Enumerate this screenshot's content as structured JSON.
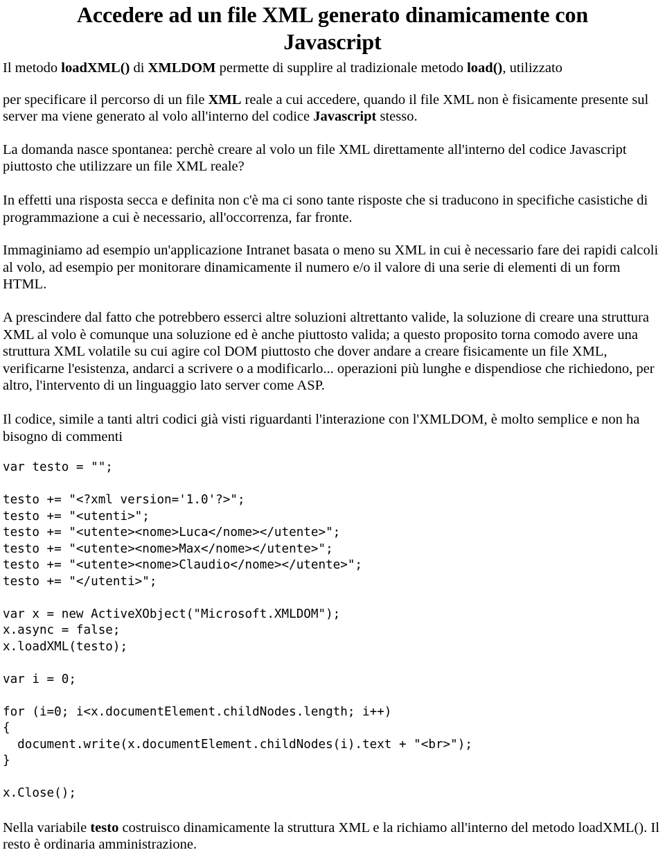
{
  "document": {
    "title_line1": "Accedere ad un file XML generato dinamicamente con",
    "title_line2": "Javascript",
    "lead": {
      "part1_a": "Il metodo ",
      "part1_b": "loadXML()",
      "part1_c": " di ",
      "part1_d": "XMLDOM",
      "part1_e": " permette di supplire al tradizionale metodo ",
      "part1_f": "load()",
      "part1_g": ", utilizzato",
      "part2_a": "per specificare il percorso di un file ",
      "part2_b": "XML",
      "part2_c": " reale a cui accedere, quando il file XML non è fisicamente presente sul server ma viene generato al volo all'interno del codice ",
      "part2_d": "Javascript",
      "part2_e": " stesso."
    },
    "paragraphs": [
      "La domanda nasce spontanea: perchè creare al volo un file XML direttamente all'interno del codice Javascript piuttosto che utilizzare un file XML reale?",
      "In effetti una risposta secca e definita non c'è ma ci sono tante risposte che si traducono in specifiche casistiche di programmazione a cui è necessario, all'occorrenza, far fronte.",
      "Immaginiamo ad esempio un'applicazione Intranet basata o meno su XML in cui è necessario fare dei rapidi calcoli al volo, ad esempio per monitorare dinamicamente il numero e/o il valore di una serie di elementi di un form HTML.",
      "A prescindere dal fatto che potrebbero esserci altre soluzioni altrettanto valide, la soluzione di creare una struttura XML al volo è comunque una soluzione ed è anche piuttosto valida; a questo proposito torna comodo avere una struttura XML volatile su cui agire col DOM piuttosto che dover andare a creare fisicamente un file XML, verificarne l'esistenza, andarci a scrivere o a modificarlo... operazioni più lunghe e dispendiose che richiedono, per altro, l'intervento di un linguaggio lato server come ASP.",
      "Il codice, simile a tanti altri codici già visti riguardanti l'interazione con l'XMLDOM, è molto semplice e non ha bisogno di commenti"
    ],
    "code": "var testo = \"\";\n\ntesto += \"<?xml version='1.0'?>\";\ntesto += \"<utenti>\";\ntesto += \"<utente><nome>Luca</nome></utente>\";\ntesto += \"<utente><nome>Max</nome></utente>\";\ntesto += \"<utente><nome>Claudio</nome></utente>\";\ntesto += \"</utenti>\";\n\nvar x = new ActiveXObject(\"Microsoft.XMLDOM\");\nx.async = false;\nx.loadXML(testo);\n\nvar i = 0;\n\nfor (i=0; i<x.documentElement.childNodes.length; i++)\n{\n  document.write(x.documentElement.childNodes(i).text + \"<br>\");\n}\n\nx.Close();",
    "closing": {
      "a": "Nella variabile ",
      "b": "testo",
      "c": " costruisco dinamicamente la struttura XML e la richiamo all'interno del metodo loadXML(). Il resto è ordinaria amministrazione."
    }
  }
}
